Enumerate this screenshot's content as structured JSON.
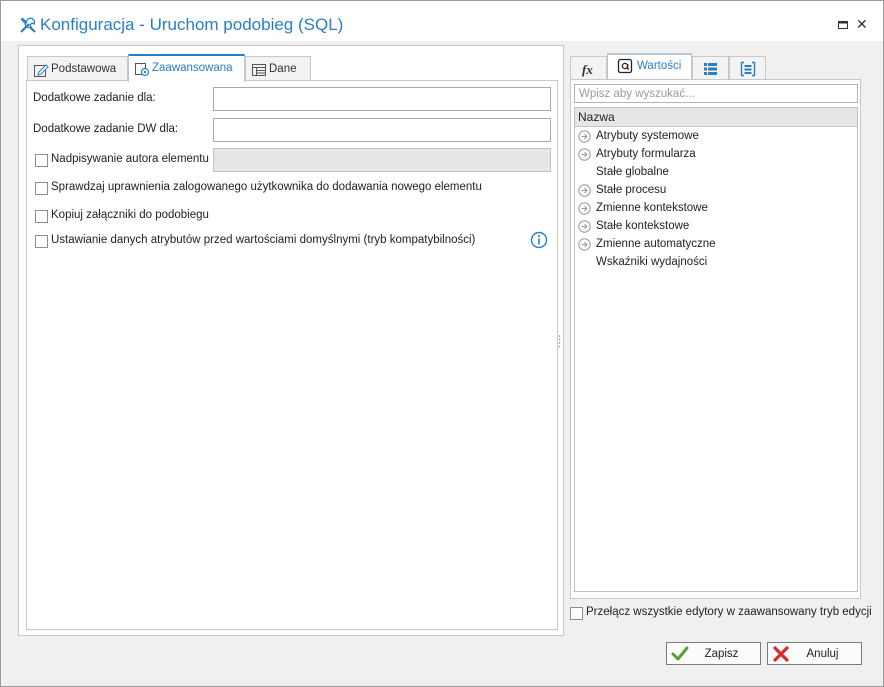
{
  "window": {
    "title": "Konfiguracja - Uruchom podobieg (SQL)",
    "title_icon": "tools-icon",
    "accent_color": "#2a7fc3"
  },
  "left_tabs": [
    {
      "label": "Podstawowa",
      "icon": "edit-icon",
      "active": false
    },
    {
      "label": "Zaawansowana",
      "icon": "advanced-settings-icon",
      "active": true
    },
    {
      "label": "Dane",
      "icon": "data-table-icon",
      "active": false
    }
  ],
  "form": {
    "additional_task_label": "Dodatkowe zadanie dla:",
    "additional_task_value": "",
    "additional_task_dw_label": "Dodatkowe zadanie DW dla:",
    "additional_task_dw_value": "",
    "checkboxes": [
      {
        "label": "Nadpisywanie autora elementu",
        "checked": false
      },
      {
        "label": "Sprawdzaj uprawnienia zalogowanego użytkownika do dodawania nowego elementu",
        "checked": false
      },
      {
        "label": "Kopiuj załączniki do podobiegu",
        "checked": false
      },
      {
        "label": "Ustawianie danych atrybutów przed wartościami domyślnymi (tryb kompatybilności)",
        "checked": false
      }
    ]
  },
  "right_tabs": [
    {
      "label": "",
      "icon": "function-icon",
      "active": false
    },
    {
      "label": "Wartości",
      "icon": "values-icon",
      "active": true
    },
    {
      "label": "",
      "icon": "list-icon",
      "active": false
    },
    {
      "label": "",
      "icon": "bracket-list-icon",
      "active": false
    }
  ],
  "values_panel": {
    "search_placeholder": "Wpisz aby wyszukać...",
    "column_header": "Nazwa",
    "items": [
      {
        "label": "Atrybuty systemowe",
        "expandable": true
      },
      {
        "label": "Atrybuty formularza",
        "expandable": true
      },
      {
        "label": "Stałe globalne",
        "expandable": false
      },
      {
        "label": "Stałe procesu",
        "expandable": true
      },
      {
        "label": "Zmienne kontekstowe",
        "expandable": true
      },
      {
        "label": "Stałe kontekstowe",
        "expandable": true
      },
      {
        "label": "Zmienne automatyczne",
        "expandable": true
      },
      {
        "label": "Wskaźniki wydajności",
        "expandable": false
      }
    ]
  },
  "advanced_mode_checkbox": {
    "label": "Przełącz wszystkie edytory w zaawansowany tryb edycji",
    "checked": false
  },
  "buttons": {
    "save_label": "Zapisz",
    "cancel_label": "Anuluj"
  }
}
